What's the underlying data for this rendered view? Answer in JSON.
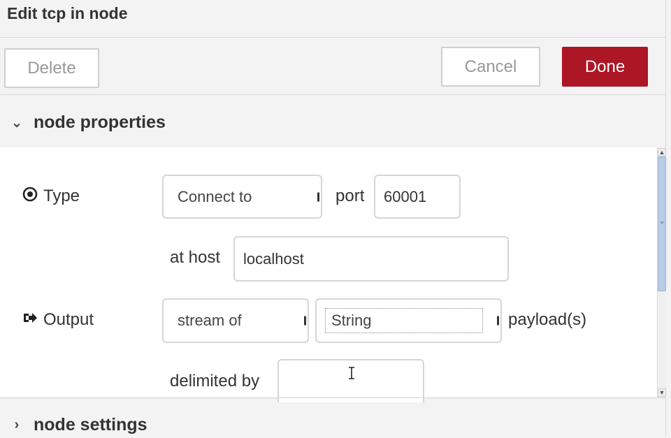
{
  "tray": {
    "title": "Edit tcp in node",
    "delete_label": "Delete",
    "cancel_label": "Cancel",
    "done_label": "Done"
  },
  "sections": {
    "properties_label": "node properties",
    "settings_label": "node settings"
  },
  "form": {
    "type_label": "Type",
    "type_value": "Connect to",
    "port_label": "port",
    "port_value": "60001",
    "host_label": "at host",
    "host_value": "localhost",
    "output_label": "Output",
    "output_mode": "stream of",
    "output_type": "String",
    "output_suffix": "payload(s)",
    "delimiter_label": "delimited by",
    "delimiter_value": ""
  },
  "icons": {
    "type_icon": "dot-circle-icon",
    "output_icon": "sign-out-icon"
  },
  "colors": {
    "primary": "#ad1625",
    "background": "#f3f3f3",
    "panel": "#ffffff"
  }
}
